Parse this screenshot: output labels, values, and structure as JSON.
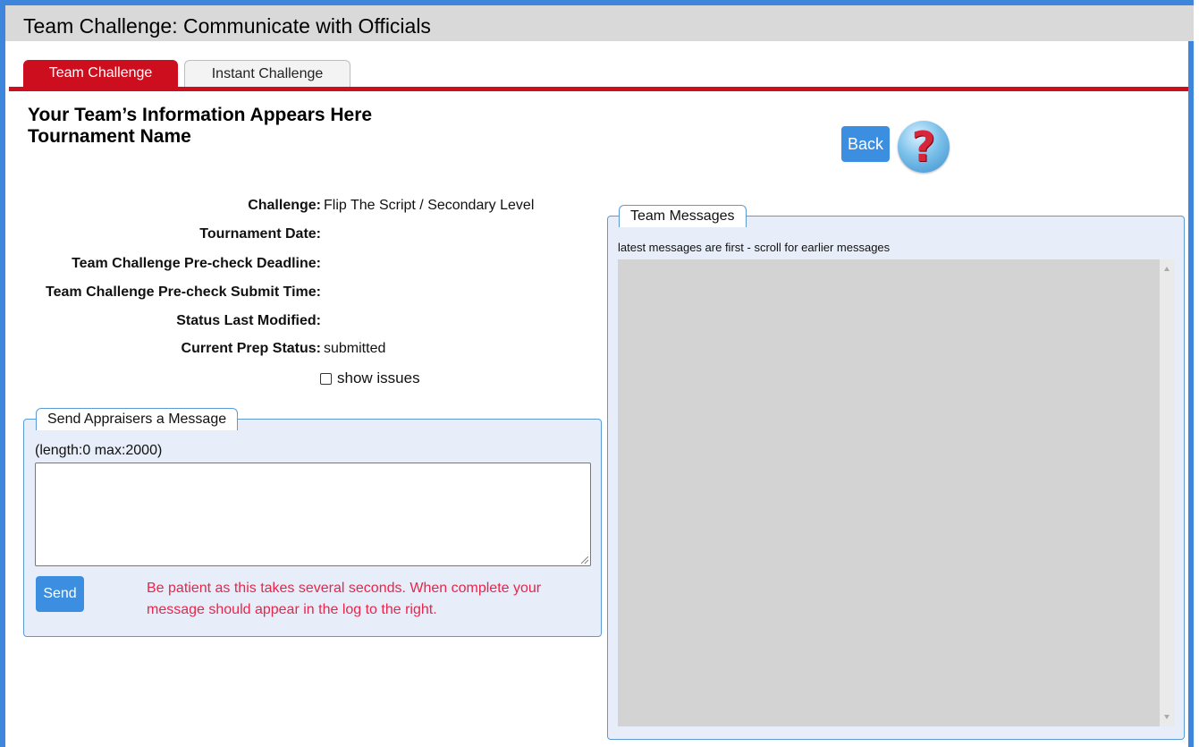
{
  "title": "Team Challenge: Communicate with Officials",
  "tabs": [
    {
      "label": "Team Challenge",
      "active": true
    },
    {
      "label": "Instant Challenge",
      "active": false
    }
  ],
  "team": {
    "info_line": "Your Team’s Information Appears Here",
    "tournament_name": "Tournament Name"
  },
  "toolbar": {
    "back_label": "Back",
    "help_glyph": "?",
    "help_icon": "help-question-icon"
  },
  "details": [
    {
      "label": "Challenge:",
      "value": "Flip The Script / Secondary Level"
    },
    {
      "label": "Tournament Date:",
      "value": ""
    },
    {
      "label": "Team Challenge Pre-check Deadline:",
      "value": ""
    },
    {
      "label": "Team Challenge Pre-check Submit Time:",
      "value": ""
    },
    {
      "label": "Status Last Modified:",
      "value": ""
    },
    {
      "label": "Current Prep Status:",
      "value": "submitted"
    }
  ],
  "show_issues": {
    "label": "show issues",
    "checked": false
  },
  "send_panel": {
    "legend": "Send Appraisers a Message",
    "length_text": "(length:0 max:2000)",
    "message_value": "",
    "send_label": "Send",
    "notice": "Be patient as this takes several seconds. When complete your message should appear in the log to the right."
  },
  "messages_panel": {
    "legend": "Team Messages",
    "hint": "latest messages are first - scroll for earlier messages",
    "messages": []
  },
  "colors": {
    "accent_red": "#cc0e1e",
    "button_blue": "#3b8ee0",
    "frame_blue": "#3d86dc",
    "notice_red": "#e8254b"
  }
}
